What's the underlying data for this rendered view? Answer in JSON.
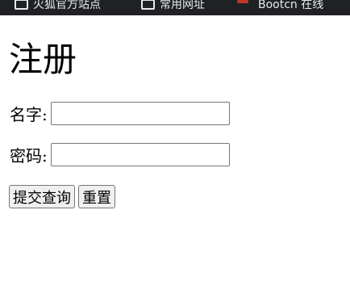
{
  "bookmarks": [
    {
      "icon": "folder-icon",
      "label": "火狐官方站点"
    },
    {
      "icon": "folder-icon",
      "label": "常用网址"
    },
    {
      "icon": "site-favicon-icon",
      "label": "Bootcn 在线"
    }
  ],
  "form": {
    "title": "注册",
    "name_label": "名字:",
    "name_value": "",
    "password_label": "密码:",
    "password_value": "",
    "submit_label": "提交查询",
    "reset_label": "重置"
  }
}
